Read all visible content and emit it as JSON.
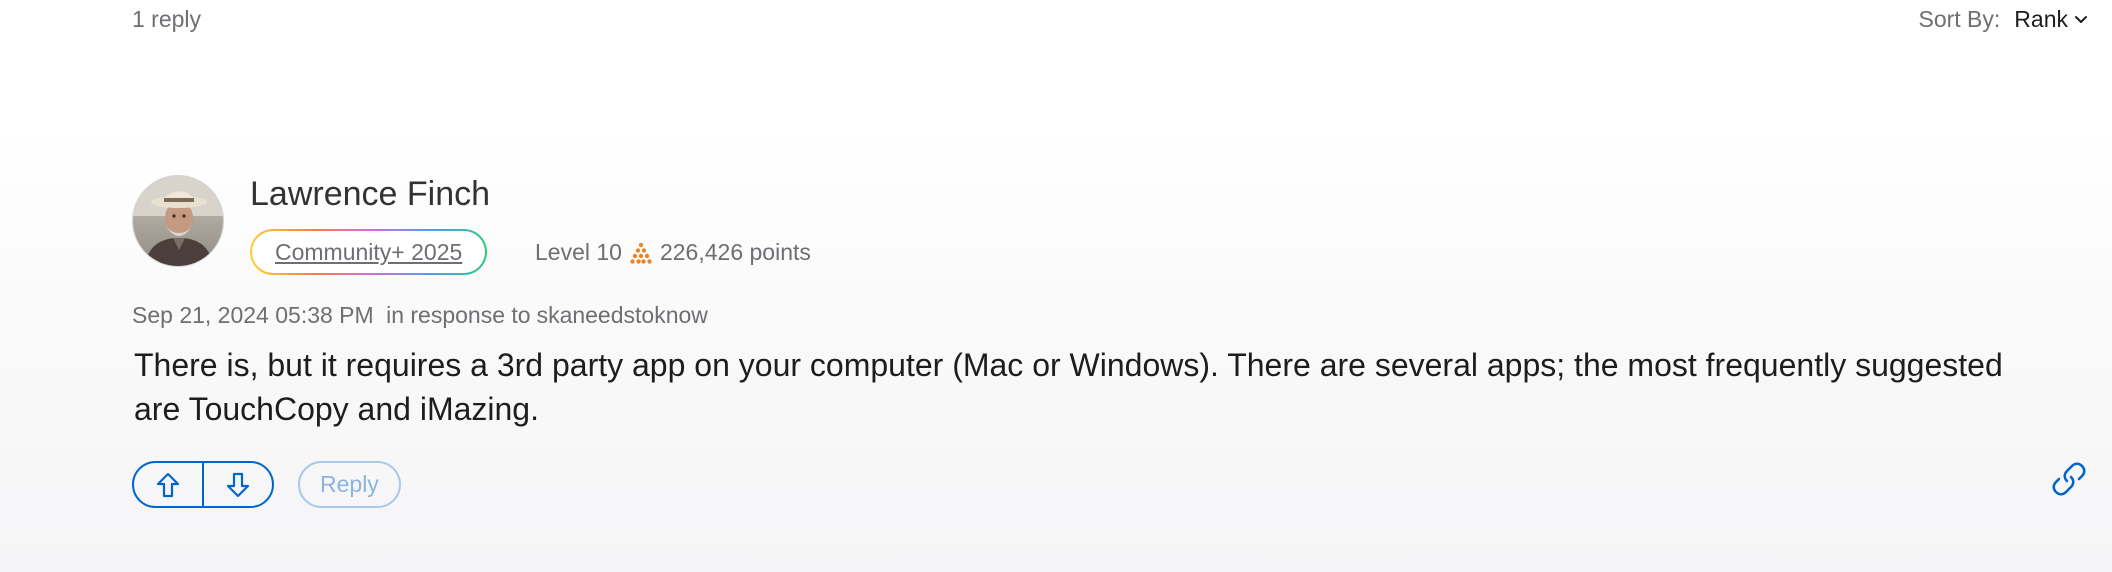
{
  "thread": {
    "reply_count": "1 reply",
    "sort_label": "Sort By:",
    "sort_value": "Rank"
  },
  "post": {
    "author": "Lawrence Finch",
    "badge": "Community+ 2025",
    "level": "Level 10",
    "points": "226,426 points",
    "date": "Sep 21, 2024 05:38 PM",
    "in_response_label": "in response to",
    "in_response_to": "skaneedstoknow",
    "body": "There is, but it requires a 3rd party app on your computer (Mac or Windows). There are several apps; the most frequently suggested are TouchCopy and iMazing."
  },
  "actions": {
    "upvote_icon": "arrow-up-icon",
    "downvote_icon": "arrow-down-icon",
    "reply_label": "Reply",
    "link_icon": "link-icon"
  },
  "colors": {
    "accent": "#0066cc",
    "secondary_text": "#6e6e73",
    "level_icon": "#e8862c",
    "reply_button_disabled": "#8cb4de"
  }
}
